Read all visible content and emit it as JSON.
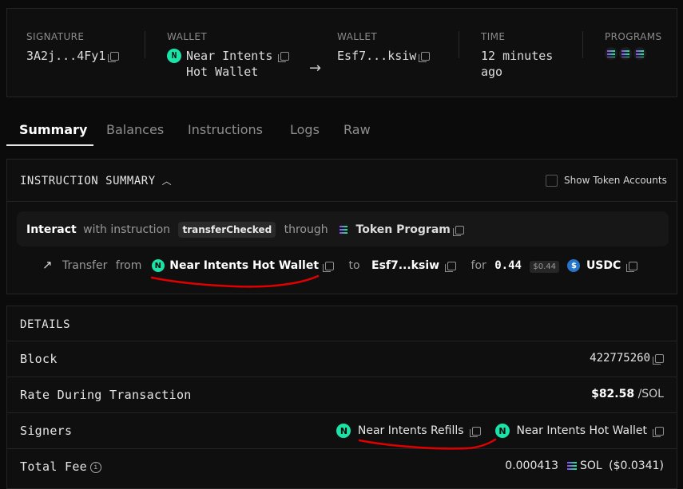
{
  "header": {
    "signature": {
      "label": "SIGNATURE",
      "value": "3A2j...4Fy1"
    },
    "from_wallet": {
      "label": "WALLET",
      "name_line1": "Near Intents",
      "name_line2": "Hot Wallet"
    },
    "to_wallet": {
      "label": "WALLET",
      "value": "Esf7...ksiw"
    },
    "time": {
      "label": "TIME",
      "line1": "12 minutes",
      "line2": "ago"
    },
    "programs": {
      "label": "PROGRAMS"
    }
  },
  "tabs": [
    "Summary",
    "Balances",
    "Instructions",
    "Logs",
    "Raw"
  ],
  "instruction_summary": {
    "title": "INSTRUCTION SUMMARY",
    "show_token_accounts": "Show Token Accounts",
    "interact": "Interact",
    "with_instruction": "with instruction",
    "instruction_name": "transferChecked",
    "through": "through",
    "program": "Token Program",
    "transfer": {
      "label": "Transfer",
      "from": "from",
      "from_wallet": "Near Intents Hot Wallet",
      "to": "to",
      "to_wallet": "Esf7...ksiw",
      "for": "for",
      "amount": "0.44",
      "usd_value": "$0.44",
      "token": "USDC"
    }
  },
  "details": {
    "title": "DETAILS",
    "block": {
      "label": "Block",
      "value": "422775260"
    },
    "rate": {
      "label": "Rate During Transaction",
      "value": "$82.58",
      "unit": "/SOL"
    },
    "signers": {
      "label": "Signers",
      "signer1": "Near Intents Refills",
      "signer2": "Near Intents Hot Wallet"
    },
    "total_fee": {
      "label": "Total Fee",
      "value": "0.000413",
      "token": "SOL",
      "usd": "($0.0341)"
    }
  },
  "colors": {
    "near": "#19e3a6",
    "annotation": "#e00000",
    "usdc": "#2775ca"
  }
}
